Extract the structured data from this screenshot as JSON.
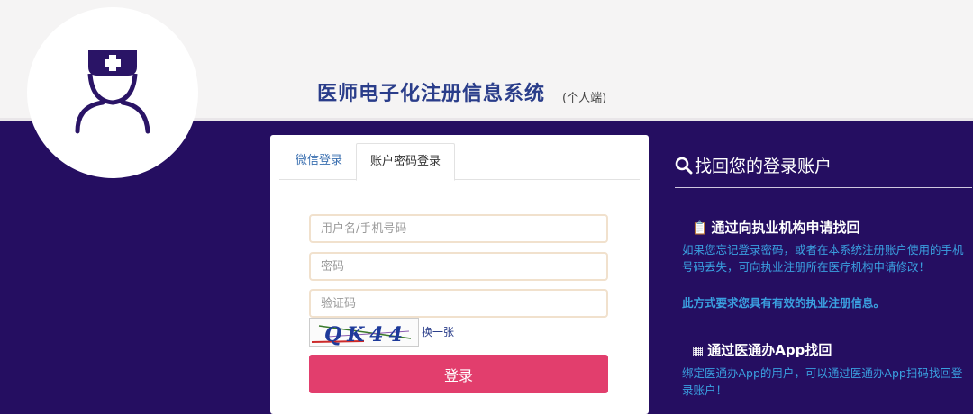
{
  "header": {
    "title": "医师电子化注册信息系统",
    "subtitle": "(个人端)",
    "logo_icon": "doctor-nurse-icon"
  },
  "login": {
    "tabs": [
      {
        "label": "微信登录",
        "active": false
      },
      {
        "label": "账户密码登录",
        "active": true
      }
    ],
    "username_placeholder": "用户名/手机号码",
    "password_placeholder": "密码",
    "captcha_placeholder": "验证码",
    "captcha_text": "QK44",
    "captcha_refresh": "换一张",
    "submit_label": "登录"
  },
  "recover": {
    "heading": "找回您的登录账户",
    "methods": [
      {
        "icon": "clipboard-icon",
        "title": "通过向执业机构申请找回",
        "description": "如果您忘记登录密码，或者在本系统注册账户使用的手机号码丢失，可向执业注册所在医疗机构申请修改！",
        "note": "此方式要求您具有有效的执业注册信息。"
      },
      {
        "icon": "grid-icon",
        "title": "通过医通办App找回",
        "description": "绑定医通办App的用户，可以通过医通办App扫码找回登录账户！"
      }
    ]
  },
  "colors": {
    "background": "#250e61",
    "header_bg": "#f5f4f4",
    "title": "#2a3d8a",
    "button": "#e23e6d",
    "link_text": "#3aa0e0"
  }
}
